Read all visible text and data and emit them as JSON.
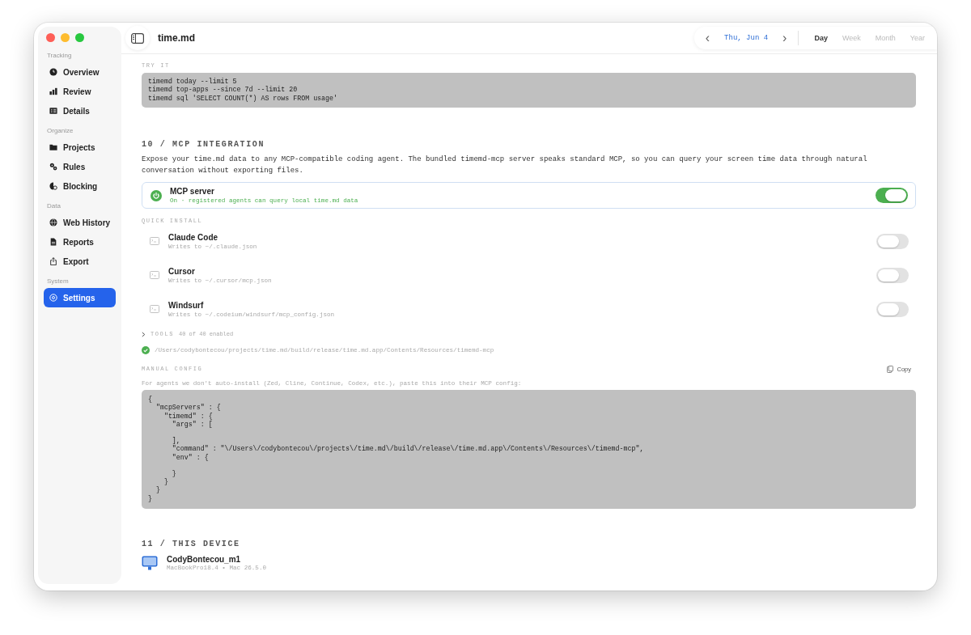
{
  "window": {
    "title": "time.md"
  },
  "sidebar": {
    "sections": [
      {
        "title": "Tracking",
        "items": [
          {
            "label": "Overview",
            "kind": "clock",
            "selected": false
          },
          {
            "label": "Review",
            "kind": "bars",
            "selected": false
          },
          {
            "label": "Details",
            "kind": "list",
            "selected": false
          }
        ]
      },
      {
        "title": "Organize",
        "items": [
          {
            "label": "Projects",
            "kind": "folder",
            "selected": false
          },
          {
            "label": "Rules",
            "kind": "gears",
            "selected": false
          },
          {
            "label": "Blocking",
            "kind": "block",
            "selected": false
          }
        ]
      },
      {
        "title": "Data",
        "items": [
          {
            "label": "Web History",
            "kind": "globe",
            "selected": false
          },
          {
            "label": "Reports",
            "kind": "doc",
            "selected": false
          },
          {
            "label": "Export",
            "kind": "share",
            "selected": false
          }
        ]
      },
      {
        "title": "System",
        "items": [
          {
            "label": "Settings",
            "kind": "gear",
            "selected": true
          }
        ]
      }
    ]
  },
  "date_nav": {
    "prev": "‹",
    "date": "Thu, Jun 4",
    "next": "›"
  },
  "ranges": [
    {
      "label": "Day",
      "selected": true
    },
    {
      "label": "Week",
      "selected": false
    },
    {
      "label": "Month",
      "selected": false
    },
    {
      "label": "Year",
      "selected": false
    }
  ],
  "try_it": {
    "label": "TRY IT",
    "code": "timemd today --limit 5\ntimemd top-apps --since 7d --limit 20\ntimemd sql 'SELECT COUNT(*) AS rows FROM usage'"
  },
  "mcp": {
    "heading": "10 / MCP INTEGRATION",
    "description": "Expose your time.md data to any MCP-compatible coding agent. The bundled timemd-mcp server speaks standard MCP, so you can query your screen time data through natural conversation without exporting files.",
    "server": {
      "title": "MCP server",
      "status": "On · registered agents can query local time.md data",
      "on": true
    },
    "quick_install_label": "QUICK INSTALL",
    "installs": [
      {
        "name": "Claude Code",
        "detail": "Writes to ~/.claude.json",
        "on": false
      },
      {
        "name": "Cursor",
        "detail": "Writes to ~/.cursor/mcp.json",
        "on": false
      },
      {
        "name": "Windsurf",
        "detail": "Writes to ~/.codeium/windsurf/mcp_config.json",
        "on": false
      }
    ],
    "tools": {
      "label": "TOOLS",
      "count": "40 of 40 enabled",
      "expanded": false
    },
    "binary": {
      "path": "/Users/codybontecou/projects/time.md/build/release/time.md.app/Contents/Resources/timemd-mcp",
      "ok": true
    },
    "manual": {
      "label": "MANUAL CONFIG",
      "copy": "Copy",
      "hint": "For agents we don't auto-install (Zed, Cline, Continue, Codex, etc.), paste this into their MCP config:",
      "code": "{\n  \"mcpServers\" : {\n    \"timemd\" : {\n      \"args\" : [\n\n      ],\n      \"command\" : \"\\/Users\\/codybontecou\\/projects\\/time.md\\/build\\/release\\/time.md.app\\/Contents\\/Resources\\/timemd-mcp\",\n      \"env\" : {\n\n      }\n    }\n  }\n}"
    }
  },
  "device": {
    "heading": "11 / THIS DEVICE",
    "name": "CodyBontecou_m1",
    "detail": "MacBookPro18.4 • Mac 26.5.0"
  }
}
